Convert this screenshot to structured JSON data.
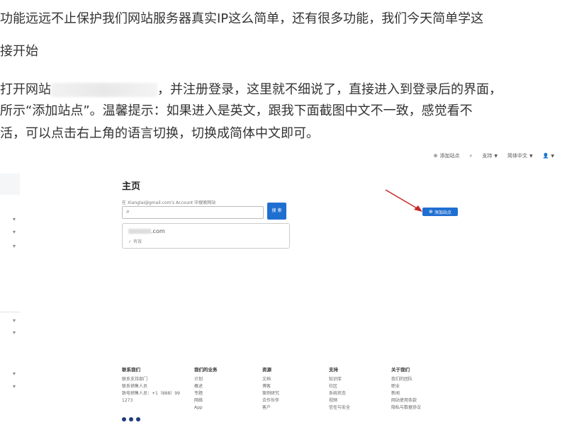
{
  "article": {
    "line1": "功能远远不止保护我们网站服务器真实IP这么简单，还有很多功能，我们今天简单学这",
    "line2": "接开始",
    "line3_pre": "打开网站",
    "line3_post": "，并注册登录，这里就不细说了，直接进入到登录后的界面，",
    "line4": "所示“添加站点”。温馨提示：如果进入是英文，跟我下面截图中文不一致，感觉看不",
    "line5": "活，可以点击右上角的语言切换，切换成简体中文即可。"
  },
  "topbar": {
    "add_site": "添加站点",
    "support": "支持",
    "language": "简体中文"
  },
  "main": {
    "title": "主页",
    "account_line": "在 Xianglai@gmail.com's Account 中搜索网站",
    "search_button": "搜 索",
    "add_site_button": "添加站点"
  },
  "site_card": {
    "domain_suffix": ".com",
    "status": "有效"
  },
  "footer": {
    "columns": [
      {
        "title": "联系我们",
        "items": [
          "联系支持部门",
          "联系销售人员",
          "致电销售人员：+1（888）99",
          "1273"
        ]
      },
      {
        "title": "我们的业务",
        "items": [
          "计划",
          "概述",
          "专题",
          "网络",
          "App"
        ]
      },
      {
        "title": "资源",
        "items": [
          "文档",
          "博客",
          "案例研究",
          "合作伙伴",
          "客户"
        ]
      },
      {
        "title": "支持",
        "items": [
          "知识库",
          "社区",
          "系统状态",
          "视频",
          "信任与安全"
        ]
      },
      {
        "title": "关于我们",
        "items": [
          "我们的团队",
          "职业",
          "新闻",
          "网站使用条款",
          "隐私与数据协议"
        ]
      }
    ]
  },
  "colors": {
    "accent": "#1f6fd1",
    "arrow": "#c62828"
  }
}
